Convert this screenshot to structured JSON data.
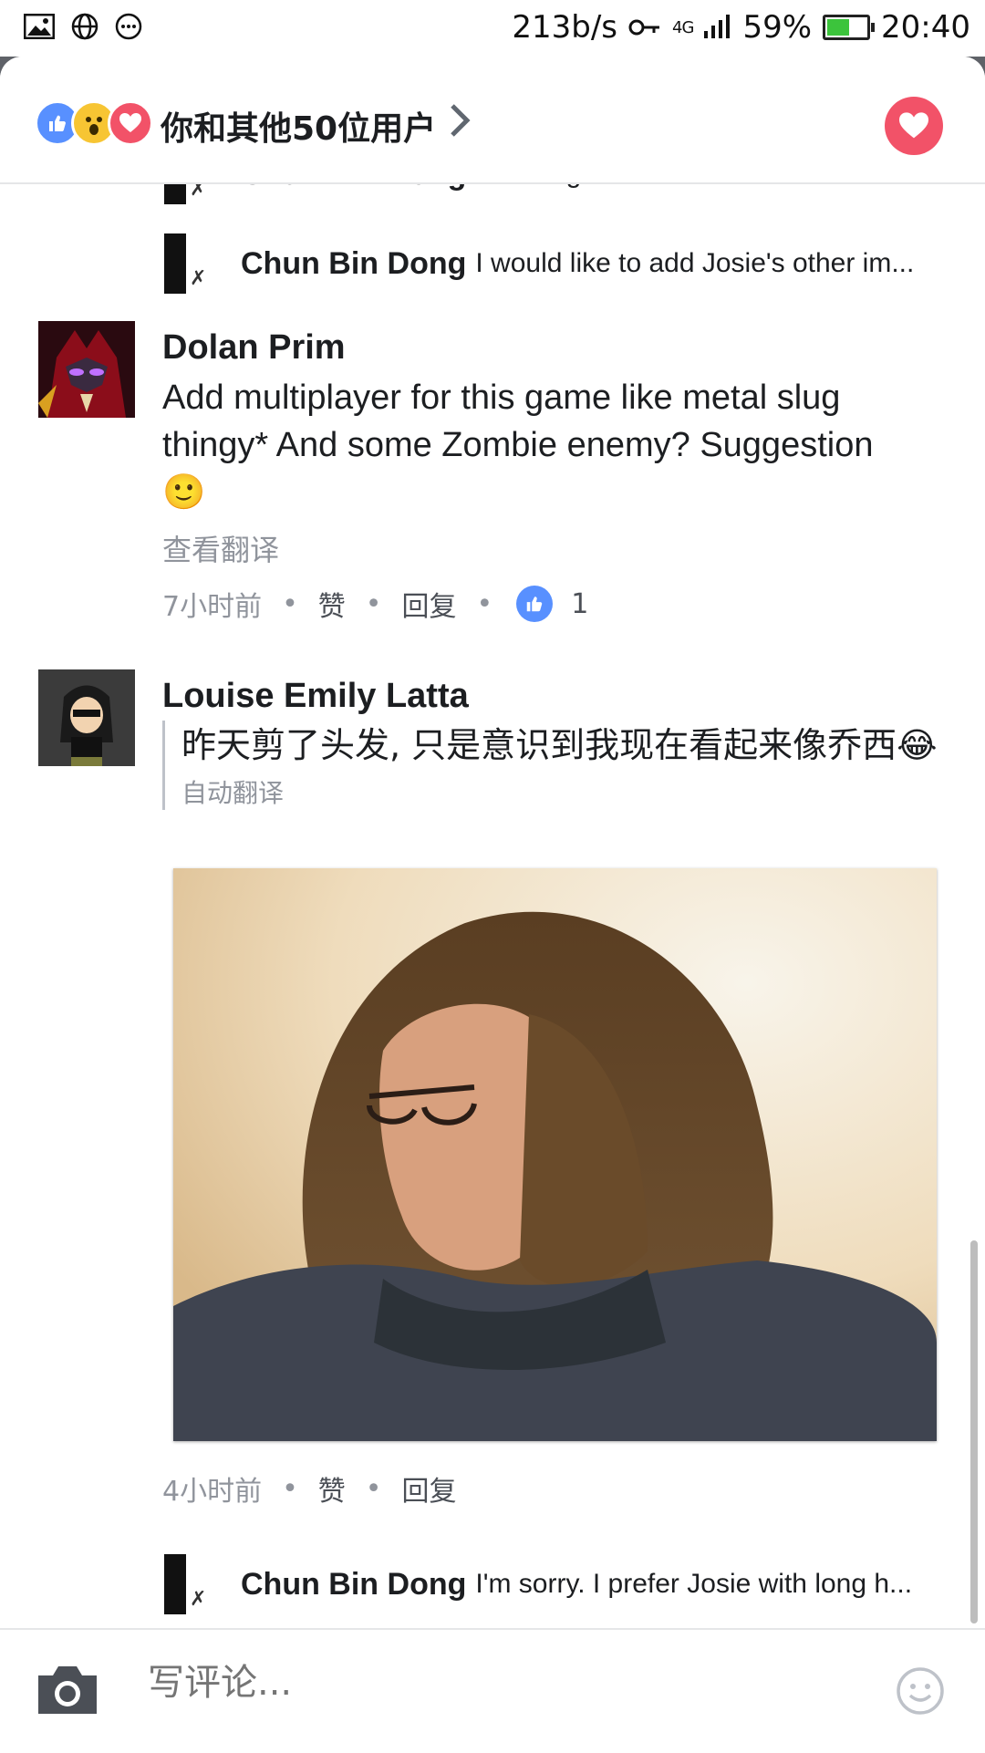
{
  "status_bar": {
    "network_speed": "213b/s",
    "network_type": "4G",
    "battery_percent": "59%",
    "battery_level": 0.59,
    "time": "20:40"
  },
  "header": {
    "reaction_icons": [
      "like-icon",
      "wow-icon",
      "love-icon"
    ],
    "summary": "你和其他50位用户",
    "love_button_icon": "heart-icon"
  },
  "comments": {
    "partial_reply": {
      "author": "Chun Bin Dong",
      "text": "Oooh~ good!"
    },
    "reply_1": {
      "author": "Chun Bin Dong",
      "text": "I would like to add Josie's other im..."
    },
    "dolan": {
      "author": "Dolan Prim",
      "text_line1": "Add multiplayer for this game like metal slug",
      "text_line2": "thingy* And some Zombie enemy? Suggestion",
      "emoji": "🙂",
      "translate_link": "查看翻译",
      "time": "7小时前",
      "like_action": "赞",
      "reply_action": "回复",
      "like_count": "1"
    },
    "louise": {
      "author": "Louise Emily Latta",
      "text": "昨天剪了头发, 只是意识到我现在看起来像乔西😂",
      "auto_translated": "自动翻译",
      "time": "4小时前",
      "like_action": "赞",
      "reply_action": "回复"
    },
    "reply_2": {
      "author": "Chun Bin Dong",
      "text": "I'm sorry. I prefer Josie with long h..."
    }
  },
  "composer": {
    "placeholder": "写评论...",
    "camera_icon": "camera-icon",
    "emoji_icon": "smiley-icon"
  },
  "colors": {
    "like_blue": "#5890ff",
    "love_red": "#f25268",
    "meta_gray": "#90949c",
    "text": "#1c1e21"
  }
}
